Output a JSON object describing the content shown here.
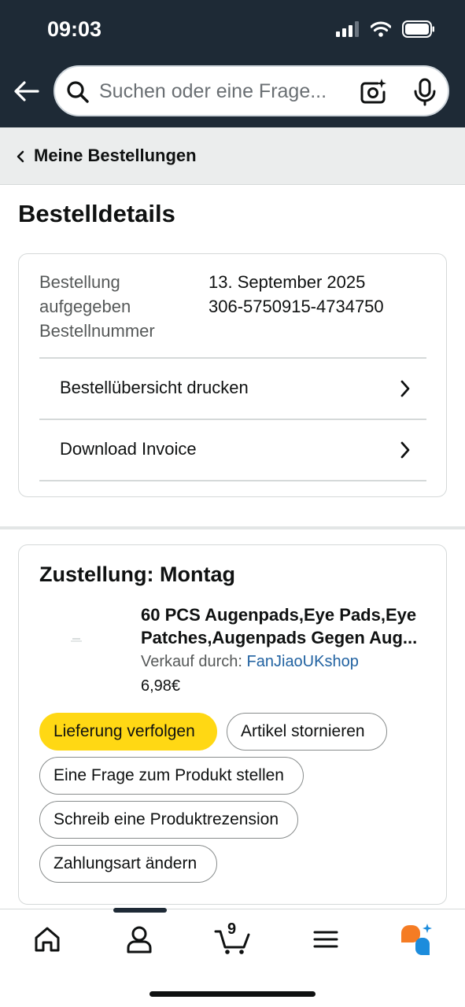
{
  "status_bar": {
    "time": "09:03"
  },
  "search": {
    "placeholder": "Suchen oder eine Frage..."
  },
  "breadcrumb": {
    "label": "Meine Bestellungen"
  },
  "page": {
    "title": "Bestelldetails"
  },
  "order_summary": {
    "labels": [
      "Bestellung",
      "aufgegeben",
      "Bestellnummer"
    ],
    "values": [
      "13. September 2025",
      "306-5750915-4734750"
    ],
    "rows": [
      {
        "label": "Bestellübersicht drucken"
      },
      {
        "label": "Download Invoice"
      }
    ]
  },
  "delivery": {
    "title": "Zustellung: Montag",
    "product": {
      "title_line1": "60 PCS Augenpads,Eye Pads,Eye",
      "title_line2": "Patches,Augenpads Gegen Aug...",
      "seller_prefix": "Verkauf durch: ",
      "seller_name": "FanJiaoUKshop",
      "price": "6,98€"
    },
    "actions": {
      "track": "Lieferung verfolgen",
      "cancel": "Artikel stornieren",
      "question": "Eine Frage zum Produkt stellen",
      "review": "Schreib eine Produktrezension",
      "payment": "Zahlungsart ändern"
    }
  },
  "bottom_nav": {
    "cart_count": "9",
    "items": [
      "home-icon",
      "account-icon",
      "cart-icon",
      "menu-icon",
      "rufus-icon"
    ]
  },
  "colors": {
    "header_bg": "#1e2a36",
    "primary_button": "#ffd814",
    "link": "#2162a1",
    "rufus_orange": "#f57c24",
    "rufus_blue": "#1c8cdc"
  }
}
